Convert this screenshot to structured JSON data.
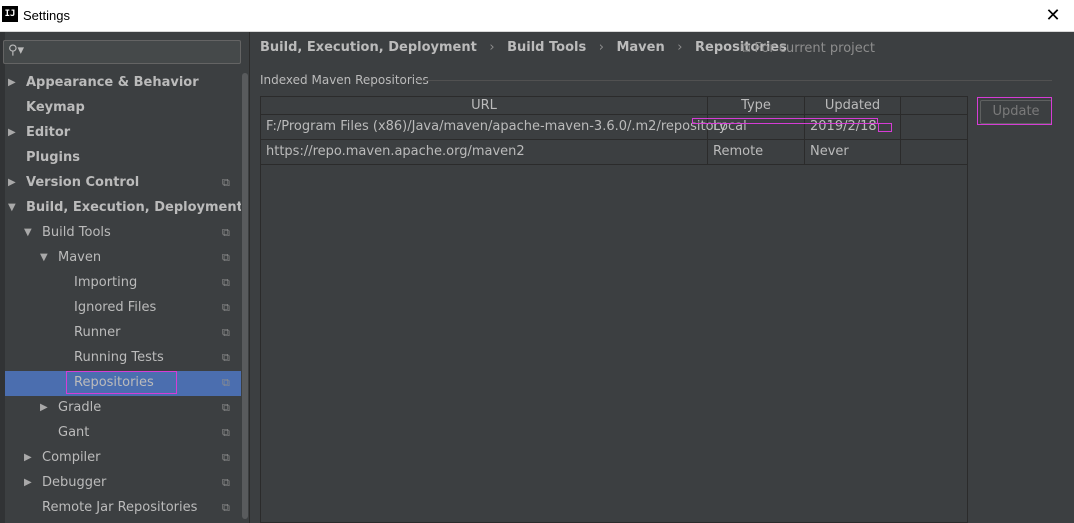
{
  "window": {
    "title": "Settings",
    "app_icon": "IJ",
    "close_glyph": "✕"
  },
  "search": {
    "placeholder": "",
    "icon": "search-icon"
  },
  "tree": {
    "items": [
      {
        "label": "Appearance & Behavior",
        "bold": true,
        "arrow": "▶"
      },
      {
        "label": "Keymap",
        "bold": true
      },
      {
        "label": "Editor",
        "bold": true,
        "arrow": "▶"
      },
      {
        "label": "Plugins",
        "bold": true
      },
      {
        "label": "Version Control",
        "bold": true,
        "arrow": "▶",
        "project_icon": true
      },
      {
        "label": "Build, Execution, Deployment",
        "bold": true,
        "arrow": "▼"
      },
      {
        "label": "Build Tools",
        "arrow": "▼",
        "project_icon": true
      },
      {
        "label": "Maven",
        "arrow": "▼",
        "project_icon": true
      },
      {
        "label": "Importing",
        "project_icon": true
      },
      {
        "label": "Ignored Files",
        "project_icon": true
      },
      {
        "label": "Runner",
        "project_icon": true
      },
      {
        "label": "Running Tests",
        "project_icon": true
      },
      {
        "label": "Repositories",
        "project_icon": true,
        "selected": true
      },
      {
        "label": "Gradle",
        "arrow": "▶",
        "project_icon": true
      },
      {
        "label": "Gant",
        "project_icon": true
      },
      {
        "label": "Compiler",
        "arrow": "▶",
        "project_icon": true
      },
      {
        "label": "Debugger",
        "arrow": "▶",
        "project_icon": true
      },
      {
        "label": "Remote Jar Repositories",
        "project_icon": true
      }
    ]
  },
  "breadcrumb": {
    "items": [
      "Build, Execution, Deployment",
      "Build Tools",
      "Maven",
      "Repositories"
    ],
    "separator": "›",
    "scope_label": "For current project"
  },
  "section": {
    "title": "Indexed Maven Repositories"
  },
  "table": {
    "headers": [
      "URL",
      "Type",
      "Updated"
    ],
    "rows": [
      [
        "F:/Program Files (x86)/Java/maven/apache-maven-3.6.0/.m2/repository",
        "Local",
        "2019/2/18"
      ],
      [
        "https://repo.maven.apache.org/maven2",
        "Remote",
        "Never"
      ]
    ]
  },
  "buttons": {
    "update_label": "Update"
  },
  "colors": {
    "background": "#3c3f41",
    "selection": "#4b6eaf",
    "annotation": "#d63cd6",
    "text": "#bbbbbb"
  }
}
